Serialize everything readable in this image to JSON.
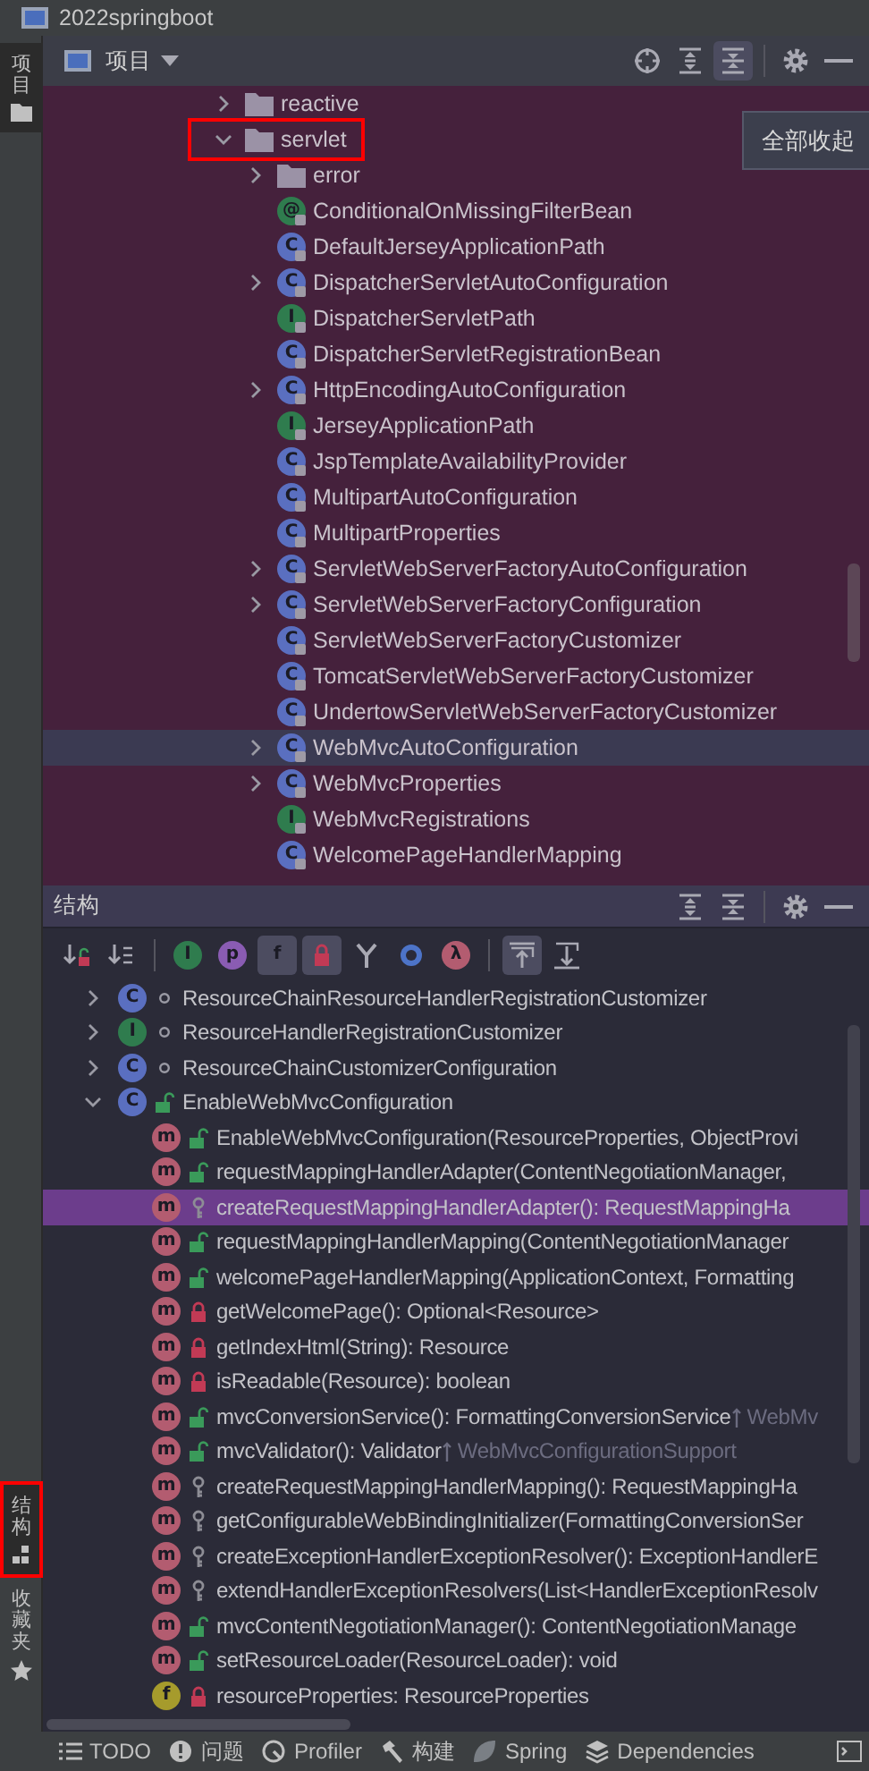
{
  "window": {
    "title": "2022springboot"
  },
  "left_strip": {
    "tabs": [
      {
        "label": "项目",
        "kind": "project",
        "selected": true
      },
      {
        "label": "结构",
        "kind": "structure",
        "selected": true,
        "highlighted": true
      },
      {
        "label": "收藏夹",
        "kind": "favorites",
        "selected": false
      }
    ]
  },
  "project_panel": {
    "title": "项目",
    "tools": [
      {
        "kind": "locate",
        "selected": false
      },
      {
        "kind": "expand-all",
        "selected": false
      },
      {
        "kind": "collapse-all",
        "selected": true
      },
      {
        "kind": "separator"
      },
      {
        "kind": "settings",
        "selected": false
      },
      {
        "kind": "hide",
        "selected": false
      }
    ],
    "tooltip": "全部收起",
    "tree": [
      {
        "label": "reactive",
        "kind": "folder",
        "expanded": false,
        "selected": false
      },
      {
        "label": "servlet",
        "kind": "folder",
        "expanded": true,
        "selected": false,
        "highlighted": true,
        "children": [
          {
            "label": "error",
            "kind": "folder",
            "expanded": false,
            "selected": false
          },
          {
            "label": "ConditionalOnMissingFilterBean",
            "kind": "annotation",
            "glyph": "@",
            "selected": false
          },
          {
            "label": "DefaultJerseyApplicationPath",
            "kind": "class",
            "glyph": "C",
            "selected": false
          },
          {
            "label": "DispatcherServletAutoConfiguration",
            "kind": "class",
            "glyph": "C",
            "expanded": false,
            "selected": false
          },
          {
            "label": "DispatcherServletPath",
            "kind": "interface",
            "glyph": "I",
            "selected": false
          },
          {
            "label": "DispatcherServletRegistrationBean",
            "kind": "class",
            "glyph": "C",
            "selected": false
          },
          {
            "label": "HttpEncodingAutoConfiguration",
            "kind": "class",
            "glyph": "C",
            "expanded": false,
            "selected": false
          },
          {
            "label": "JerseyApplicationPath",
            "kind": "interface",
            "glyph": "I",
            "selected": false
          },
          {
            "label": "JspTemplateAvailabilityProvider",
            "kind": "class",
            "glyph": "C",
            "selected": false
          },
          {
            "label": "MultipartAutoConfiguration",
            "kind": "class",
            "glyph": "C",
            "selected": false
          },
          {
            "label": "MultipartProperties",
            "kind": "class",
            "glyph": "C",
            "selected": false
          },
          {
            "label": "ServletWebServerFactoryAutoConfiguration",
            "kind": "class",
            "glyph": "C",
            "expanded": false,
            "selected": false
          },
          {
            "label": "ServletWebServerFactoryConfiguration",
            "kind": "class",
            "glyph": "C",
            "expanded": false,
            "selected": false
          },
          {
            "label": "ServletWebServerFactoryCustomizer",
            "kind": "class",
            "glyph": "C",
            "selected": false
          },
          {
            "label": "TomcatServletWebServerFactoryCustomizer",
            "kind": "class",
            "glyph": "C",
            "selected": false
          },
          {
            "label": "UndertowServletWebServerFactoryCustomizer",
            "kind": "class",
            "glyph": "C",
            "selected": false
          },
          {
            "label": "WebMvcAutoConfiguration",
            "kind": "class",
            "glyph": "C",
            "expanded": false,
            "selected": true
          },
          {
            "label": "WebMvcProperties",
            "kind": "class",
            "glyph": "C",
            "expanded": false,
            "selected": false
          },
          {
            "label": "WebMvcRegistrations",
            "kind": "interface",
            "glyph": "I",
            "selected": false
          },
          {
            "label": "WelcomePageHandlerMapping",
            "kind": "class",
            "glyph": "C",
            "selected": false
          }
        ]
      }
    ]
  },
  "structure_panel": {
    "title": "结构",
    "tools": [
      {
        "kind": "expand-all",
        "selected": false
      },
      {
        "kind": "collapse-all",
        "selected": false
      },
      {
        "kind": "separator"
      },
      {
        "kind": "settings",
        "selected": false
      },
      {
        "kind": "hide",
        "selected": false
      }
    ],
    "toolbar": [
      {
        "kind": "sort-visibility",
        "selected": false
      },
      {
        "kind": "sort-alpha",
        "selected": false
      },
      {
        "kind": "separator"
      },
      {
        "kind": "inherited",
        "glyph": "I",
        "selected": false
      },
      {
        "kind": "properties",
        "glyph": "p",
        "selected": false
      },
      {
        "kind": "fields",
        "glyph": "f",
        "selected": true
      },
      {
        "kind": "non-public",
        "selected": true
      },
      {
        "kind": "merge",
        "selected": false
      },
      {
        "kind": "anonymous",
        "selected": false
      },
      {
        "kind": "lambda",
        "glyph": "λ",
        "selected": false
      },
      {
        "kind": "separator"
      },
      {
        "kind": "autoscroll-to-source",
        "selected": true
      },
      {
        "kind": "autoscroll-from-source",
        "selected": false
      }
    ],
    "tree": [
      {
        "label": "ResourceChainResourceHandlerRegistrationCustomizer",
        "kind": "class-package",
        "glyph": "C",
        "expanded": false,
        "selected": false
      },
      {
        "label": "ResourceHandlerRegistrationCustomizer",
        "kind": "interface-package",
        "glyph": "I",
        "expanded": false,
        "selected": false
      },
      {
        "label": "ResourceChainCustomizerConfiguration",
        "kind": "class-package",
        "glyph": "C",
        "expanded": false,
        "selected": false
      },
      {
        "label": "EnableWebMvcConfiguration",
        "kind": "class-public",
        "glyph": "C",
        "expanded": true,
        "selected": false,
        "children": [
          {
            "label": "EnableWebMvcConfiguration(ResourceProperties, ObjectProvi",
            "kind": "method-public",
            "glyph": "m",
            "selected": false
          },
          {
            "label": "requestMappingHandlerAdapter(ContentNegotiationManager,",
            "kind": "method-public",
            "glyph": "m",
            "selected": false
          },
          {
            "label": "createRequestMappingHandlerAdapter(): RequestMappingHa",
            "kind": "method-protected",
            "glyph": "m",
            "selected": true
          },
          {
            "label": "requestMappingHandlerMapping(ContentNegotiationManager",
            "kind": "method-public",
            "glyph": "m",
            "selected": false
          },
          {
            "label": "welcomePageHandlerMapping(ApplicationContext, Formatting",
            "kind": "method-public",
            "glyph": "m",
            "selected": false
          },
          {
            "label": "getWelcomePage(): Optional<Resource>",
            "kind": "method-private",
            "glyph": "m",
            "selected": false
          },
          {
            "label": "getIndexHtml(String): Resource",
            "kind": "method-private",
            "glyph": "m",
            "selected": false
          },
          {
            "label": "isReadable(Resource): boolean",
            "kind": "method-private",
            "glyph": "m",
            "selected": false
          },
          {
            "label": "mvcConversionService(): FormattingConversionService",
            "kind": "method-public",
            "glyph": "m",
            "selected": false,
            "inherited_from": "WebMv"
          },
          {
            "label": "mvcValidator(): Validator",
            "kind": "method-public",
            "glyph": "m",
            "selected": false,
            "inherited_from": "WebMvcConfigurationSupport"
          },
          {
            "label": "createRequestMappingHandlerMapping(): RequestMappingHa",
            "kind": "method-protected",
            "glyph": "m",
            "selected": false
          },
          {
            "label": "getConfigurableWebBindingInitializer(FormattingConversionSer",
            "kind": "method-protected",
            "glyph": "m",
            "selected": false
          },
          {
            "label": "createExceptionHandlerExceptionResolver(): ExceptionHandlerE",
            "kind": "method-protected",
            "glyph": "m",
            "selected": false
          },
          {
            "label": "extendHandlerExceptionResolvers(List<HandlerExceptionResolv",
            "kind": "method-protected",
            "glyph": "m",
            "selected": false
          },
          {
            "label": "mvcContentNegotiationManager(): ContentNegotiationManage",
            "kind": "method-public",
            "glyph": "m",
            "selected": false
          },
          {
            "label": "setResourceLoader(ResourceLoader): void",
            "kind": "method-public",
            "glyph": "m",
            "selected": false
          },
          {
            "label": "resourceProperties: ResourceProperties",
            "kind": "field-private",
            "glyph": "f",
            "selected": false
          }
        ]
      }
    ]
  },
  "bottom_bar": [
    {
      "label": "TODO",
      "kind": "todo"
    },
    {
      "label": "问题",
      "kind": "problems"
    },
    {
      "label": "Profiler",
      "kind": "profiler"
    },
    {
      "label": "构建",
      "kind": "build"
    },
    {
      "label": "Spring",
      "kind": "spring"
    },
    {
      "label": "Dependencies",
      "kind": "dependencies"
    },
    {
      "kind": "terminal"
    }
  ]
}
